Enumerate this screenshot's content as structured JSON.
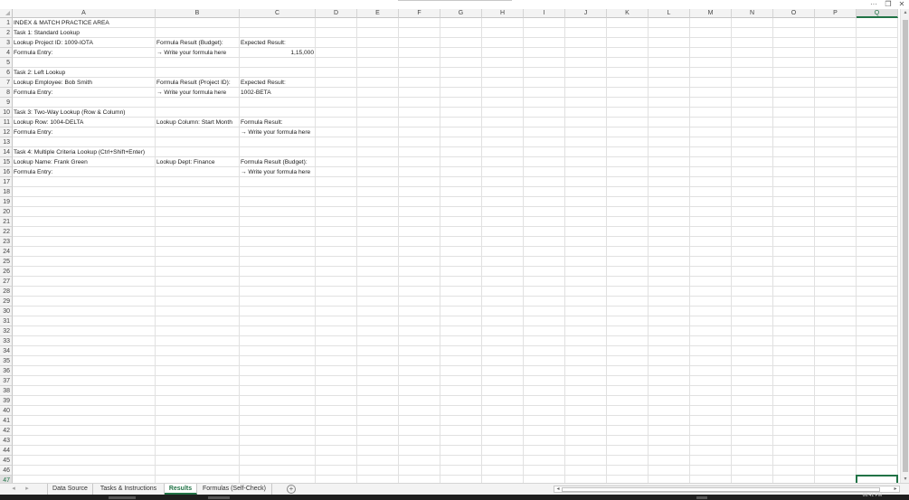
{
  "window": {
    "more_icon": "···",
    "restore_icon": "❐",
    "close_icon": "✕"
  },
  "columns": [
    "A",
    "B",
    "C",
    "D",
    "E",
    "F",
    "G",
    "H",
    "I",
    "J",
    "K",
    "L",
    "M",
    "N",
    "O",
    "P",
    "Q"
  ],
  "rows": [
    "1",
    "2",
    "3",
    "4",
    "5",
    "6",
    "7",
    "8",
    "9",
    "10",
    "11",
    "12",
    "13",
    "14",
    "15",
    "16",
    "17",
    "18",
    "19",
    "20",
    "21",
    "22",
    "23",
    "24",
    "25",
    "26",
    "27",
    "28",
    "29",
    "30",
    "31",
    "32",
    "33",
    "34",
    "35",
    "36",
    "37",
    "38",
    "39",
    "40",
    "41",
    "42",
    "43",
    "44",
    "45",
    "46",
    "47"
  ],
  "active_cell": {
    "column": "Q",
    "row": "47"
  },
  "cells": {
    "A1": "INDEX & MATCH PRACTICE AREA",
    "A2": "Task 1: Standard Lookup",
    "A3": "Lookup Project ID: 1009-IOTA",
    "B3": "Formula Result (Budget):",
    "C3": "Expected Result:",
    "A4": "Formula Entry:",
    "B4": "→ Write your formula here",
    "C4": "1,15,000",
    "A6": "Task 2: Left Lookup",
    "A7": "Lookup Employee: Bob Smith",
    "B7": "Formula Result (Project ID):",
    "C7": "Expected Result:",
    "A8": "Formula Entry:",
    "B8": "→ Write your formula here",
    "C8": "1002-BETA",
    "A10": "Task 3: Two-Way Lookup (Row & Column)",
    "A11": "Lookup Row: 1004-DELTA",
    "B11": "Lookup Column: Start Month",
    "C11": "Formula Result:",
    "A12": "Formula Entry:",
    "C12": "→ Write your formula here",
    "A14": "Task 4: Multiple Criteria Lookup (Ctrl+Shift+Enter)",
    "A15": "Lookup Name: Frank Green",
    "B15": "Lookup Dept: Finance",
    "C15": "Formula Result (Budget):",
    "A16": "Formula Entry:",
    "C16": "→ Write your formula here"
  },
  "sheet_tabs": {
    "nav_prev": "◂",
    "nav_next": "▸",
    "tabs": [
      "Data Source",
      "Tasks & Instructions",
      "Results",
      "Formulas (Self-Check)"
    ],
    "active": "Results",
    "add_label": "+"
  },
  "scroll": {
    "up": "▴",
    "down": "▾",
    "left": "◂",
    "right": "▸"
  },
  "taskbar": {
    "time": "06:41 PM"
  },
  "colors": {
    "accent": "#217346",
    "gridline": "#e1e1e1",
    "header_bg": "#f3f3f3"
  }
}
